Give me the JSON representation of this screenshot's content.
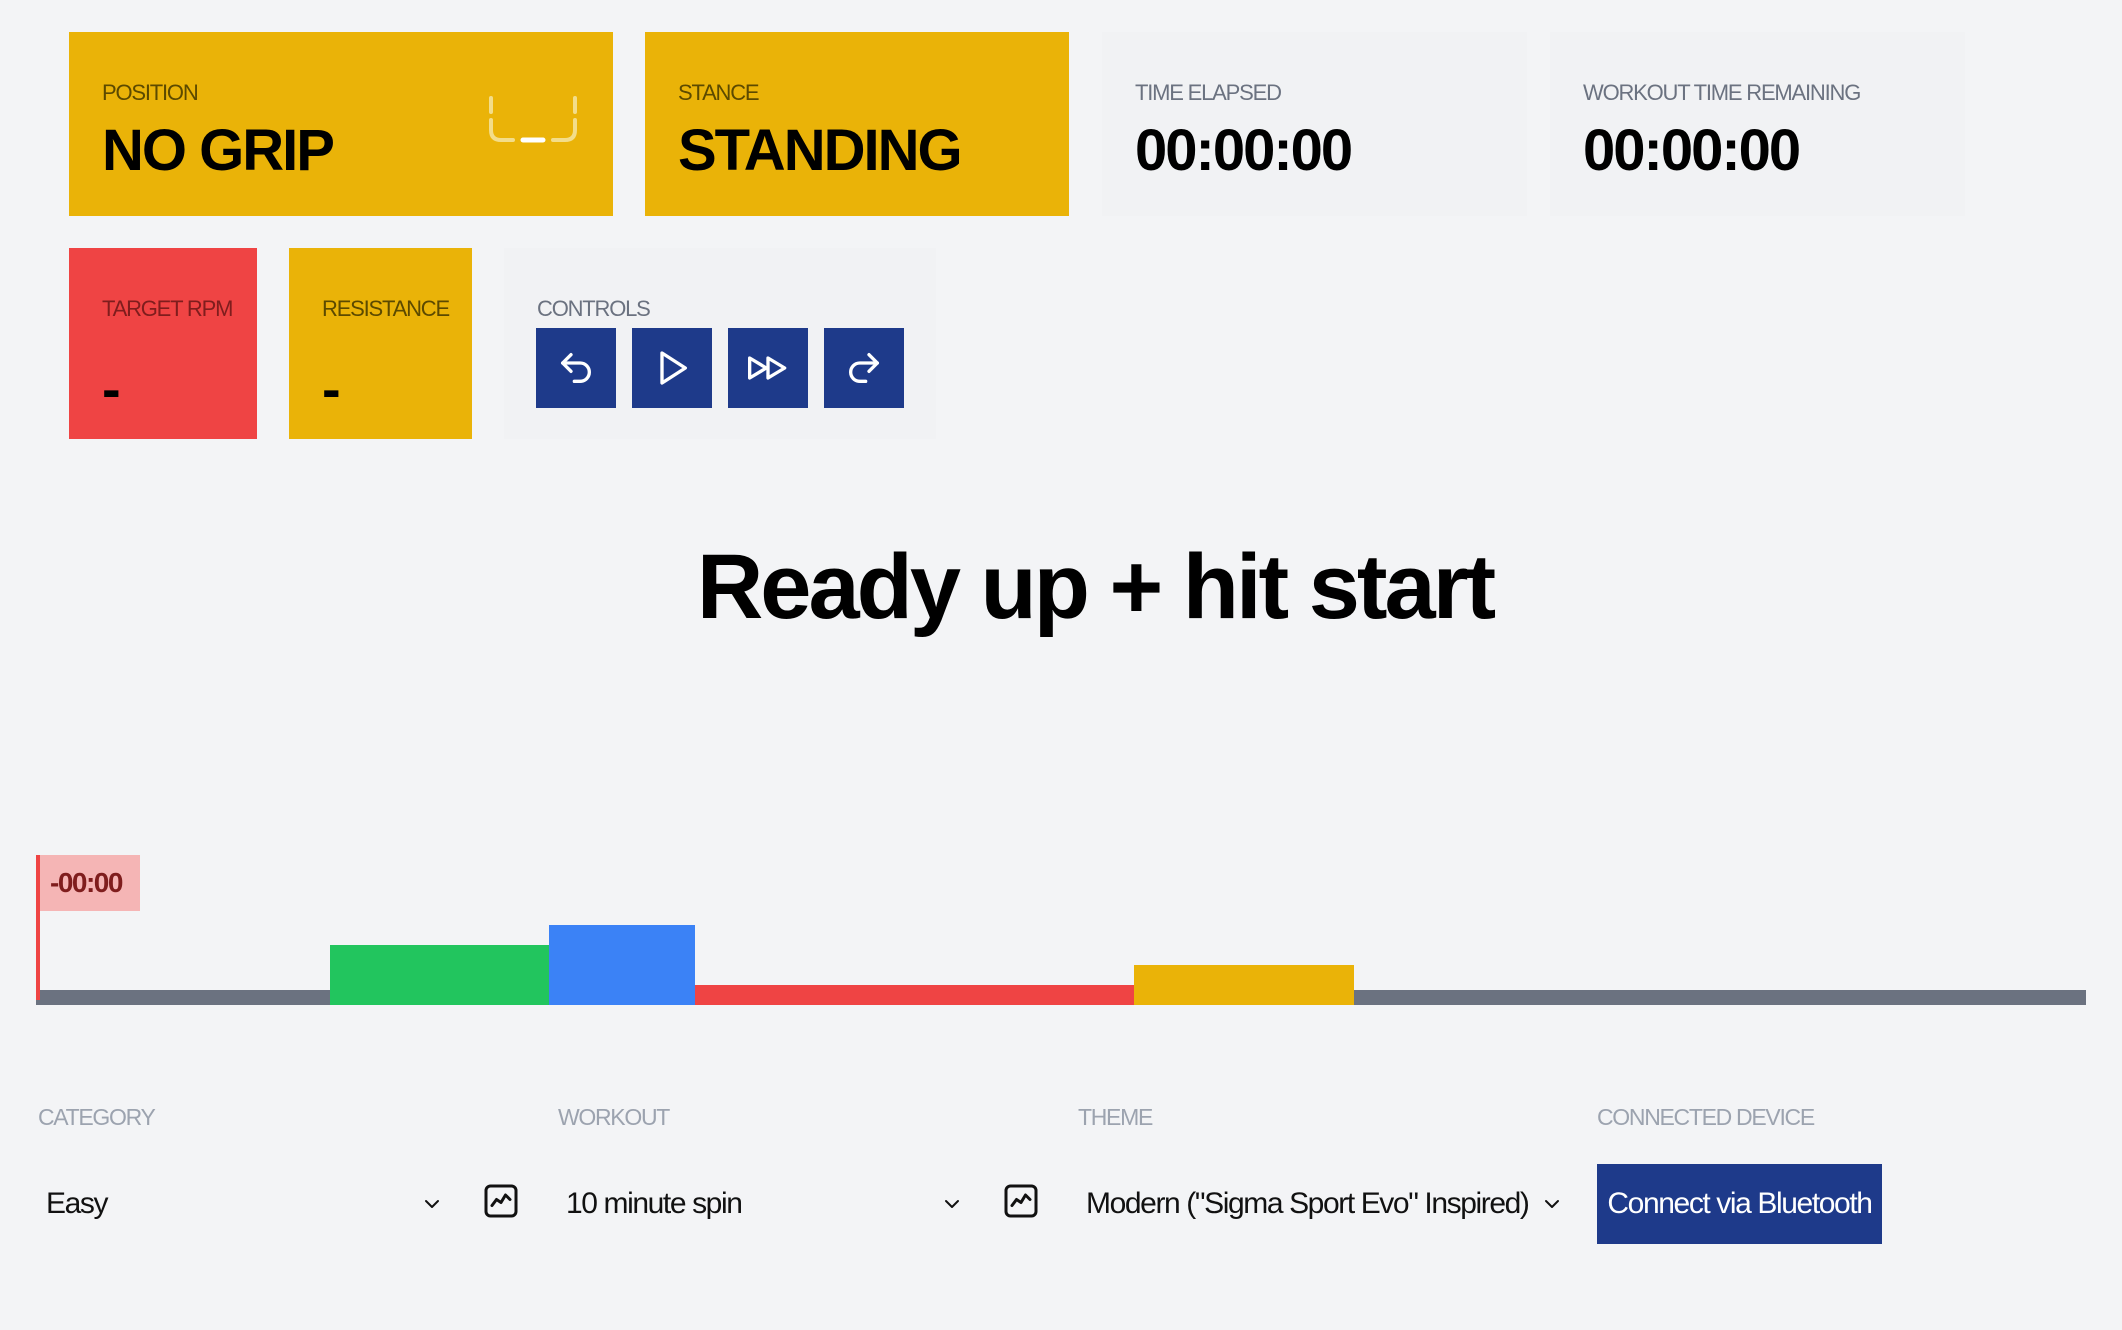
{
  "status": {
    "position": {
      "label": "POSITION",
      "value": "NO GRIP"
    },
    "stance": {
      "label": "STANCE",
      "value": "STANDING"
    },
    "time_elapsed": {
      "label": "TIME ELAPSED",
      "value": "00:00:00"
    },
    "workout_remaining": {
      "label": "WORKOUT TIME REMAINING",
      "value": "00:00:00"
    },
    "target_rpm": {
      "label": "TARGET RPM",
      "value": "-"
    },
    "resistance": {
      "label": "RESISTANCE",
      "value": "-"
    }
  },
  "controls": {
    "label": "CONTROLS",
    "buttons": [
      "back-icon",
      "play-icon",
      "fast-forward-icon",
      "forward-icon"
    ]
  },
  "headline": "Ready up + hit start",
  "timeline": {
    "marker": "-00:00",
    "colors": {
      "grey": "#6b7280",
      "green": "#22c55e",
      "blue": "#3b82f6",
      "red": "#ef4444",
      "yellow": "#eab308"
    }
  },
  "bottom": {
    "category": {
      "label": "CATEGORY",
      "value": "Easy"
    },
    "workout": {
      "label": "WORKOUT",
      "value": "10 minute spin"
    },
    "theme": {
      "label": "THEME",
      "value": "Modern (\"Sigma Sport Evo\" Inspired)"
    },
    "device": {
      "label": "CONNECTED DEVICE",
      "button": "Connect via Bluetooth"
    }
  },
  "colors": {
    "yellow": "#eab308",
    "red": "#ef4444",
    "navy": "#1e3a8a",
    "background": "#f3f4f6"
  }
}
